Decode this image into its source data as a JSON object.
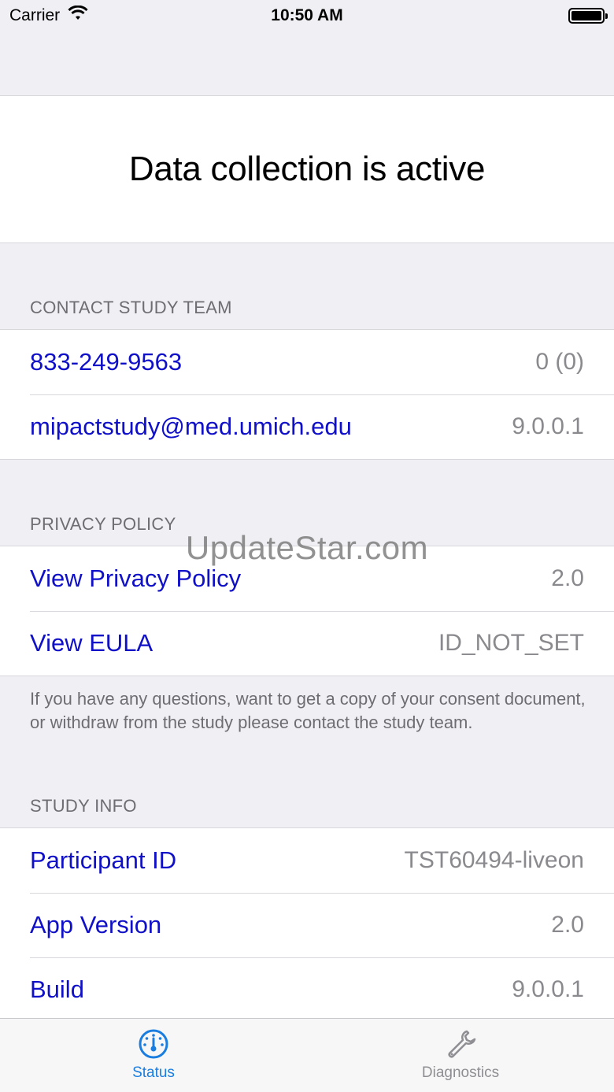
{
  "status_bar": {
    "carrier": "Carrier",
    "time": "10:50 AM"
  },
  "hero": {
    "title": "Data collection is active"
  },
  "sections": {
    "contact": {
      "header": "CONTACT STUDY TEAM",
      "rows": [
        {
          "label": "833-249-9563",
          "value": "0 (0)"
        },
        {
          "label": "mipactstudy@med.umich.edu",
          "value": "9.0.0.1"
        }
      ]
    },
    "privacy": {
      "header": "PRIVACY POLICY",
      "rows": [
        {
          "label": "View Privacy Policy",
          "value": "2.0"
        },
        {
          "label": "View EULA",
          "value": "ID_NOT_SET"
        }
      ],
      "footer": "If you have any questions, want to get a copy of your consent document, or withdraw from the study please contact the study team."
    },
    "study_info": {
      "header": "STUDY INFO",
      "rows": [
        {
          "label": "Participant ID",
          "value": "TST60494-liveon"
        },
        {
          "label": "App Version",
          "value": "2.0"
        },
        {
          "label": "Build",
          "value": "9.0.0.1"
        }
      ]
    }
  },
  "watermark": "UpdateStar.com",
  "tab_bar": {
    "tabs": [
      {
        "label": "Status",
        "icon": "gauge-icon",
        "active": true
      },
      {
        "label": "Diagnostics",
        "icon": "wrench-icon",
        "active": false
      }
    ]
  },
  "colors": {
    "link": "#1010c8",
    "accent": "#1a7de0",
    "secondary_text": "#8a8a8e",
    "background": "#efeff4"
  }
}
